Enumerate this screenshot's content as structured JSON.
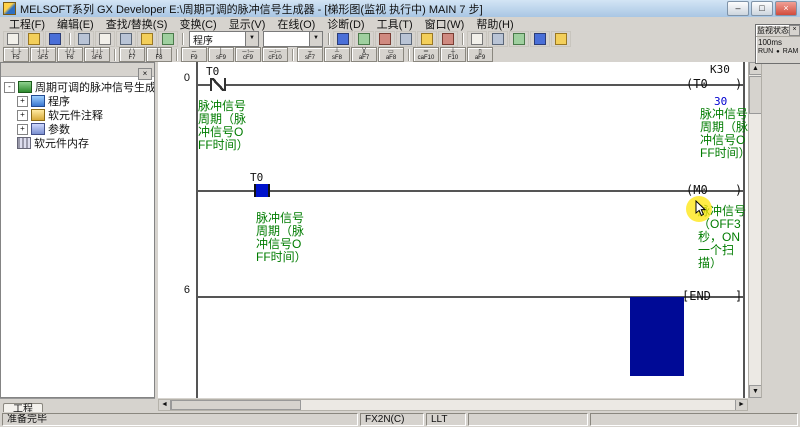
{
  "colors": {
    "title_from": "#d3e5f5",
    "title_to": "#a9c6e4",
    "comment": "#007c00",
    "monitor_value": "#0000d0",
    "energized": "#0013cc",
    "cursor_block": "#000a96",
    "ladder_line": "#555555"
  },
  "window": {
    "title": "MELSOFT系列 GX Developer E:\\周期可调的脉冲信号生成器 - [梯形图(监视 执行中)   MAIN   7 步]",
    "minimize": "–",
    "maximize": "□",
    "close": "×"
  },
  "menu": {
    "items": [
      "工程(F)",
      "编辑(E)",
      "查找/替换(S)",
      "变换(C)",
      "显示(V)",
      "在线(O)",
      "诊断(D)",
      "工具(T)",
      "窗口(W)",
      "帮助(H)"
    ]
  },
  "toolbar1": {
    "program_combo": "程序",
    "target_combo": "",
    "dropdown": "▼",
    "icons": [
      "new",
      "open",
      "save",
      "print",
      "cut",
      "copy",
      "paste",
      "undo",
      "download-to-plc",
      "upload-from-plc",
      "verify-with-plc",
      "ladder-monitor",
      "monitor-start",
      "monitor-stop",
      "find",
      "zoom",
      "device-comment",
      "statement",
      "help"
    ]
  },
  "toolbar2": {
    "buttons": [
      {
        "sym": "┤ ├",
        "key": "F5"
      },
      {
        "sym": "┤↑├",
        "key": "sF5"
      },
      {
        "sym": "┤/├",
        "key": "F6"
      },
      {
        "sym": "┤↓├",
        "key": "sF6"
      },
      {
        "sym": "( )",
        "key": "F7"
      },
      {
        "sym": "[ ]",
        "key": "F8"
      },
      {
        "sym": "─",
        "key": "F9"
      },
      {
        "sym": "│",
        "key": "sF9"
      },
      {
        "sym": "─↑─",
        "key": "cF9"
      },
      {
        "sym": "─↓─",
        "key": "cF10"
      },
      {
        "sym": "┬",
        "key": "sF7"
      },
      {
        "sym": "┴",
        "key": "sF8"
      },
      {
        "sym": "╳",
        "key": "aF7"
      },
      {
        "sym": "▭",
        "key": "aF8"
      },
      {
        "sym": "═",
        "key": "caF10"
      },
      {
        "sym": "┼",
        "key": "F10"
      },
      {
        "sym": "▯",
        "key": "aF9"
      }
    ]
  },
  "project": {
    "panel_close": "×",
    "root": "周期可调的脉冲信号生成器",
    "items": [
      "程序",
      "软元件注释",
      "参数",
      "软元件内存"
    ],
    "collapse_glyph": "-",
    "expand_glyph": "+",
    "tab": "工程"
  },
  "ladder": {
    "rung0": {
      "number": "0",
      "contact_label": "T0",
      "contact_comment": "脉冲信号周期（脉冲信号OFF时间）",
      "coil_constant": "K30",
      "coil": "(T0",
      "coil_close": ")",
      "coil_value": "30",
      "coil_comment": "脉冲信号周期（脉冲信号OFF时间）"
    },
    "branch": {
      "contact_label": "T0",
      "contact_comment": "脉冲信号周期（脉冲信号OFF时间）",
      "coil": "(M0",
      "coil_close": ")",
      "coil_comment": "脉冲信号（OFF3秒，ON一个扫描）"
    },
    "end_rung": {
      "number": "6",
      "instruction": "[END",
      "instruction_close": "]"
    }
  },
  "monitor": {
    "title": "监视状态",
    "close_label": "×",
    "scan_time": "100ms",
    "run_state": "RUN",
    "indicator": "●",
    "memory": "RAM"
  },
  "statusbar": {
    "ready": "准备完毕",
    "plc_type": "FX2N(C)",
    "mode": "LLT"
  },
  "scroll": {
    "up": "▲",
    "down": "▼",
    "left": "◄",
    "right": "►"
  }
}
